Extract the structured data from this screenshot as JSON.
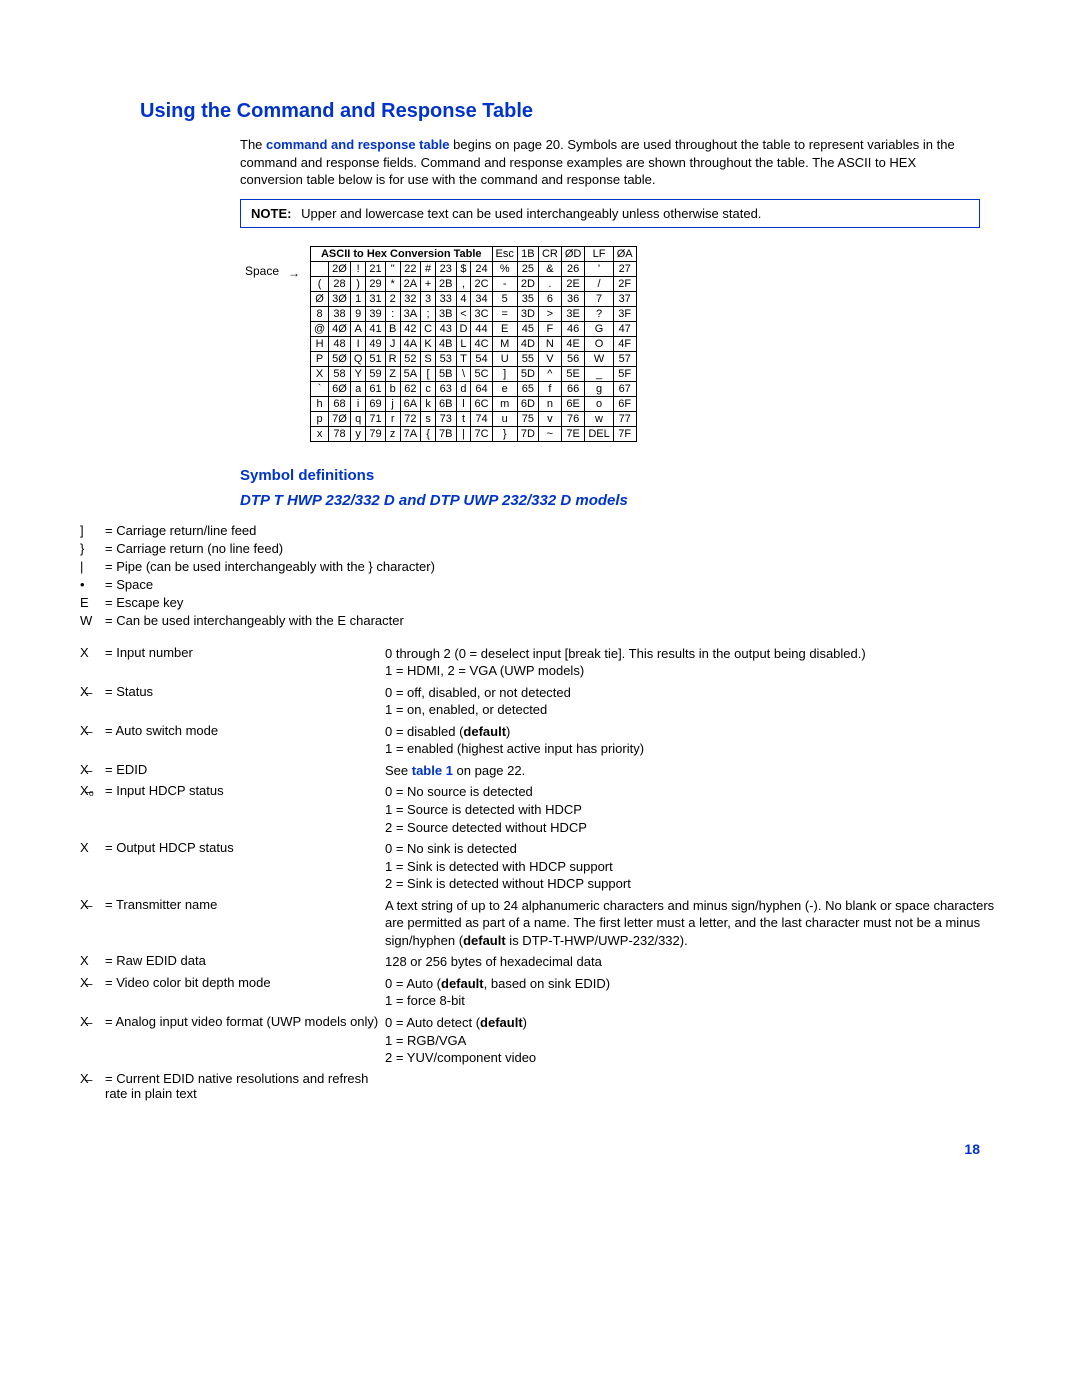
{
  "h1": "Using the Command and Response Table",
  "intro": {
    "pre": "The ",
    "link": "command and response table",
    "post": " begins on page 20. Symbols are used throughout the table to represent variables in the command and response fields. Command and response examples are shown throughout the table. The ASCII to HEX conversion table below is for use with the command and response table."
  },
  "note": {
    "label": "NOTE:",
    "text": "Upper and lowercase text can be used interchangeably unless otherwise stated."
  },
  "ascii": {
    "title": "ASCII to Hex  Conversion Table",
    "side_label": "Space",
    "header_extra": [
      [
        "Esc",
        "1B"
      ],
      [
        "CR",
        "ØD"
      ],
      [
        "LF",
        "ØA"
      ]
    ],
    "rows": [
      [
        [
          "",
          "2Ø"
        ],
        [
          "!",
          "21"
        ],
        [
          "\"",
          "22"
        ],
        [
          "#",
          "23"
        ],
        [
          "$",
          "24"
        ],
        [
          "%",
          "25"
        ],
        [
          "&",
          "26"
        ],
        [
          "'",
          "27"
        ]
      ],
      [
        [
          "(",
          "28"
        ],
        [
          ")",
          "29"
        ],
        [
          "*",
          "2A"
        ],
        [
          "+",
          "2B"
        ],
        [
          ",",
          "2C"
        ],
        [
          "-",
          "2D"
        ],
        [
          ".",
          "2E"
        ],
        [
          "/",
          "2F"
        ]
      ],
      [
        [
          "Ø",
          "3Ø"
        ],
        [
          "1",
          "31"
        ],
        [
          "2",
          "32"
        ],
        [
          "3",
          "33"
        ],
        [
          "4",
          "34"
        ],
        [
          "5",
          "35"
        ],
        [
          "6",
          "36"
        ],
        [
          "7",
          "37"
        ]
      ],
      [
        [
          "8",
          "38"
        ],
        [
          "9",
          "39"
        ],
        [
          ":",
          "3A"
        ],
        [
          ";",
          "3B"
        ],
        [
          "<",
          "3C"
        ],
        [
          "=",
          "3D"
        ],
        [
          ">",
          "3E"
        ],
        [
          "?",
          "3F"
        ]
      ],
      [
        [
          "@",
          "4Ø"
        ],
        [
          "A",
          "41"
        ],
        [
          "B",
          "42"
        ],
        [
          "C",
          "43"
        ],
        [
          "D",
          "44"
        ],
        [
          "E",
          "45"
        ],
        [
          "F",
          "46"
        ],
        [
          "G",
          "47"
        ]
      ],
      [
        [
          "H",
          "48"
        ],
        [
          "I",
          "49"
        ],
        [
          "J",
          "4A"
        ],
        [
          "K",
          "4B"
        ],
        [
          "L",
          "4C"
        ],
        [
          "M",
          "4D"
        ],
        [
          "N",
          "4E"
        ],
        [
          "O",
          "4F"
        ]
      ],
      [
        [
          "P",
          "5Ø"
        ],
        [
          "Q",
          "51"
        ],
        [
          "R",
          "52"
        ],
        [
          "S",
          "53"
        ],
        [
          "T",
          "54"
        ],
        [
          "U",
          "55"
        ],
        [
          "V",
          "56"
        ],
        [
          "W",
          "57"
        ]
      ],
      [
        [
          "X",
          "58"
        ],
        [
          "Y",
          "59"
        ],
        [
          "Z",
          "5A"
        ],
        [
          "[",
          "5B"
        ],
        [
          "\\",
          "5C"
        ],
        [
          "]",
          "5D"
        ],
        [
          "^",
          "5E"
        ],
        [
          "_",
          "5F"
        ]
      ],
      [
        [
          "`",
          "6Ø"
        ],
        [
          "a",
          "61"
        ],
        [
          "b",
          "62"
        ],
        [
          "c",
          "63"
        ],
        [
          "d",
          "64"
        ],
        [
          "e",
          "65"
        ],
        [
          "f",
          "66"
        ],
        [
          "g",
          "67"
        ]
      ],
      [
        [
          "h",
          "68"
        ],
        [
          "i",
          "69"
        ],
        [
          "j",
          "6A"
        ],
        [
          "k",
          "6B"
        ],
        [
          "l",
          "6C"
        ],
        [
          "m",
          "6D"
        ],
        [
          "n",
          "6E"
        ],
        [
          "o",
          "6F"
        ]
      ],
      [
        [
          "p",
          "7Ø"
        ],
        [
          "q",
          "71"
        ],
        [
          "r",
          "72"
        ],
        [
          "s",
          "73"
        ],
        [
          "t",
          "74"
        ],
        [
          "u",
          "75"
        ],
        [
          "v",
          "76"
        ],
        [
          "w",
          "77"
        ]
      ],
      [
        [
          "x",
          "78"
        ],
        [
          "y",
          "79"
        ],
        [
          "z",
          "7A"
        ],
        [
          "{",
          "7B"
        ],
        [
          "|",
          "7C"
        ],
        [
          "}",
          "7D"
        ],
        [
          "~",
          "7E"
        ],
        [
          "DEL",
          "7F"
        ]
      ]
    ]
  },
  "h2": "Symbol definitions",
  "h3": "DTP T HWP 232/332 D and DTP UWP 232/332 D models",
  "symbols": [
    {
      "sym": "]",
      "def": "Carriage return/line feed"
    },
    {
      "sym": "}",
      "def": "Carriage return (no line feed)"
    },
    {
      "sym": "|",
      "def": "Pipe (can be used interchangeably with the  }    character)"
    },
    {
      "sym": "•",
      "def": "Space"
    },
    {
      "sym": "E",
      "def": "Escape key"
    },
    {
      "sym": "W",
      "def": "Can be used interchangeably with the  E    character"
    }
  ],
  "defs": [
    {
      "sym": "X",
      "name": "Input number",
      "expl": "0 through 2 (0 = deselect input [break tie]. This results in the output being disabled.)\n1 = HDMI, 2 = VGA (UWP models)"
    },
    {
      "sym": "X̶",
      "name": "Status",
      "expl": "0 = off, disabled, or not detected\n1 = on, enabled, or detected"
    },
    {
      "sym": "X̶",
      "name": "Auto switch mode",
      "expl": "0 = disabled (**default**)\n1 = enabled (highest active input has priority)"
    },
    {
      "sym": "X̶",
      "name": "EDID",
      "expl": "See **table 1** on page 22."
    },
    {
      "sym": "X̶₀",
      "name": "Input HDCP status",
      "expl": "0 = No source is detected\n1 = Source is detected with HDCP\n2 = Source detected without HDCP"
    },
    {
      "sym": "X",
      "name": "Output HDCP status",
      "expl": "0 = No sink is detected\n1 = Sink is detected with HDCP support\n2 = Sink is detected without HDCP support"
    },
    {
      "sym": "X̶",
      "name": "Transmitter name",
      "expl": "A text string of up to 24 alphanumeric characters and minus sign/hyphen (-). No blank or space characters are permitted as part of a name. The first letter must a letter, and the last character must not be a minus sign/hyphen (**default** is DTP-T-HWP/UWP-232/332)."
    },
    {
      "sym": "X",
      "name": "Raw EDID data",
      "expl": "128 or 256 bytes of hexadecimal data"
    },
    {
      "sym": "X̶",
      "name": "Video color bit depth mode",
      "expl": "0  = Auto (**default**, based on sink EDID)\n1  = force 8-bit"
    },
    {
      "sym": "X̶",
      "name": "Analog input video format (UWP models only)",
      "expl": "0  = Auto detect (**default**)\n1  = RGB/VGA\n2  = YUV/component video"
    },
    {
      "sym": "X̶",
      "name": "Current EDID native resolutions and refresh rate in plain text",
      "expl": ""
    }
  ],
  "page_number": "18"
}
